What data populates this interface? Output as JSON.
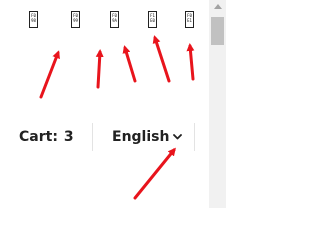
{
  "glyph_boxes": [
    {
      "line1": "F0",
      "line2": "98"
    },
    {
      "line1": "F0",
      "line2": "99"
    },
    {
      "line1": "F0",
      "line2": "9A"
    },
    {
      "line1": "F1",
      "line2": "E0"
    },
    {
      "line1": "F0",
      "line2": "E1"
    }
  ],
  "cart": {
    "label": "Cart:",
    "count": "3"
  },
  "language": {
    "selected": "English",
    "icon": "chevron-down-icon"
  },
  "annotation": {
    "arrow_color": "#e8141c"
  },
  "colors": {
    "text": "#222222",
    "divider": "#e3e3e3",
    "scroll_track": "#f1f1f1",
    "scroll_thumb": "#c1c1c1"
  }
}
